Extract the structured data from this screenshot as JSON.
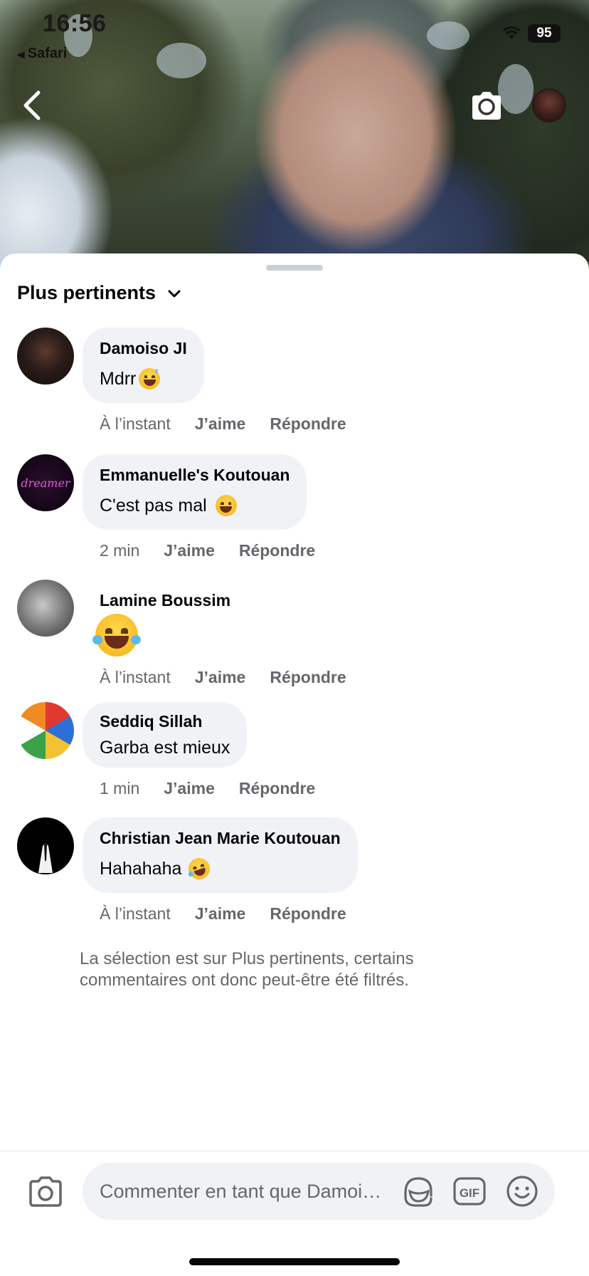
{
  "status_bar": {
    "time": "16:56",
    "back_app": "Safari",
    "battery": "95"
  },
  "header": {
    "back_icon": "chevron-left-icon",
    "camera_icon": "camera-icon",
    "profile_icon": "profile-avatar"
  },
  "sort": {
    "label": "Plus pertinents",
    "icon": "chevron-down-icon"
  },
  "comments": [
    {
      "author": "Damoiso JI",
      "text": "Mdrr",
      "emoji": "grinning-sweat",
      "time": "À l’instant",
      "like": "J’aime",
      "reply": "Répondre"
    },
    {
      "author": "Emmanuelle's Koutouan",
      "text": "C'est pas mal",
      "emoji": "laughing-squint",
      "time": "2 min",
      "like": "J’aime",
      "reply": "Répondre"
    },
    {
      "author": "Lamine Boussim",
      "text": "",
      "emoji": "tears-of-joy",
      "time": "À l’instant",
      "like": "J’aime",
      "reply": "Répondre"
    },
    {
      "author": "Seddiq Sillah",
      "text": "Garba est mieux",
      "emoji": "",
      "time": "1 min",
      "like": "J’aime",
      "reply": "Répondre"
    },
    {
      "author": "Christian Jean Marie Koutouan",
      "text": "Hahahaha",
      "emoji": "rolling-laughing",
      "time": "À l’instant",
      "like": "J’aime",
      "reply": "Répondre"
    }
  ],
  "filter_note": "La sélection est sur Plus pertinents, certains commentaires ont donc peut-être été filtrés.",
  "composer": {
    "placeholder": "Commenter en tant que Damoi…",
    "camera_icon": "camera-icon",
    "sticker_icon": "avatar-sticker-icon",
    "gif_label": "GIF",
    "emoji_icon": "emoji-icon"
  },
  "colors": {
    "bubble": "#f0f2f5",
    "secondary_text": "#65676b",
    "primary_text": "#050505"
  }
}
